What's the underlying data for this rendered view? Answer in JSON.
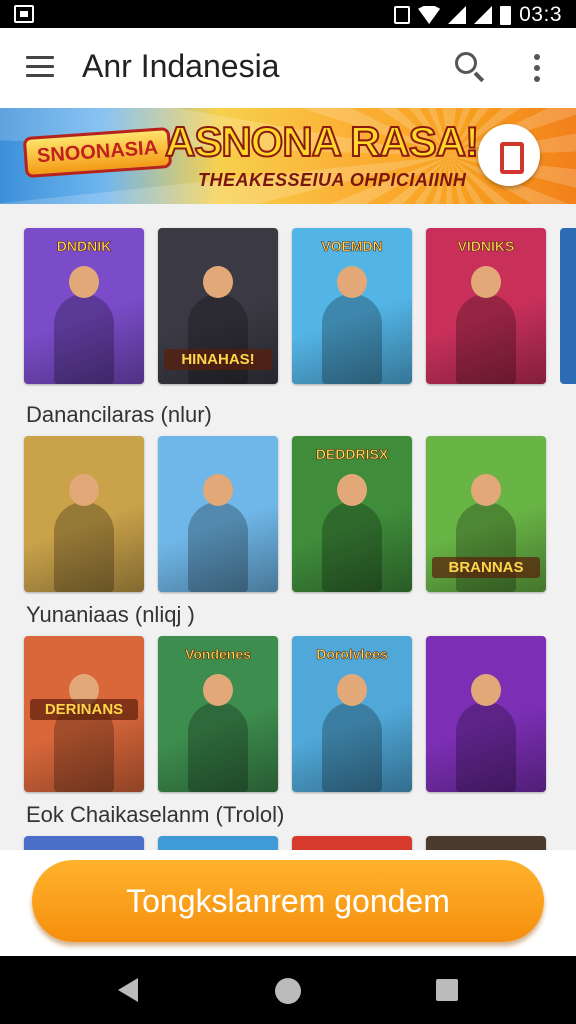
{
  "status_bar": {
    "time": "03:3",
    "icons": [
      "sim-icon",
      "vibrate-icon",
      "wifi-icon",
      "signal-icon",
      "signal-icon",
      "battery-icon"
    ]
  },
  "app_bar": {
    "title": "Anr Indanesia",
    "icons": [
      "menu-icon",
      "search-icon",
      "more-vert-icon"
    ]
  },
  "banner": {
    "logo": "SNOONASIA",
    "headline": "ASNONA RASA!",
    "subheadline": "THEAKESSEIUA OHPICIAIINH"
  },
  "sections": [
    {
      "title": "",
      "tiles": [
        {
          "caption": "DNDNIK",
          "banner_text": "",
          "color": "#7a4cc9"
        },
        {
          "caption": "",
          "banner_text": "HINAHAS!",
          "color": "#3b3a44"
        },
        {
          "caption": "VOEMDN",
          "banner_text": "",
          "color": "#53b4e6"
        },
        {
          "caption": "VIDNIKS",
          "banner_text": "",
          "color": "#c8305a"
        }
      ]
    },
    {
      "title": "Danancilaras (nlur)",
      "tiles": [
        {
          "caption": "",
          "banner_text": "",
          "color": "#c9a24a"
        },
        {
          "caption": "",
          "banner_text": "",
          "color": "#6fb7e8"
        },
        {
          "caption": "DEDDRISX",
          "banner_text": "",
          "color": "#3f8d3b"
        },
        {
          "caption": "",
          "banner_text": "BRANNAS",
          "color": "#68b445"
        }
      ]
    },
    {
      "title": "Yunaniaas (nliqj )",
      "tiles": [
        {
          "caption": "",
          "banner_text": "DERINANS",
          "color": "#d9673a"
        },
        {
          "caption": "Vondenes",
          "banner_text": "",
          "color": "#3d8d4e"
        },
        {
          "caption": "Dorolvlees",
          "banner_text": "",
          "color": "#4fa8d8"
        },
        {
          "caption": "",
          "banner_text": "",
          "color": "#7c2fb5"
        }
      ]
    },
    {
      "title": "Eok Chaikaselanm (Trolol)",
      "tiles": []
    }
  ],
  "cta_label": "Tongkslanrem gondem"
}
